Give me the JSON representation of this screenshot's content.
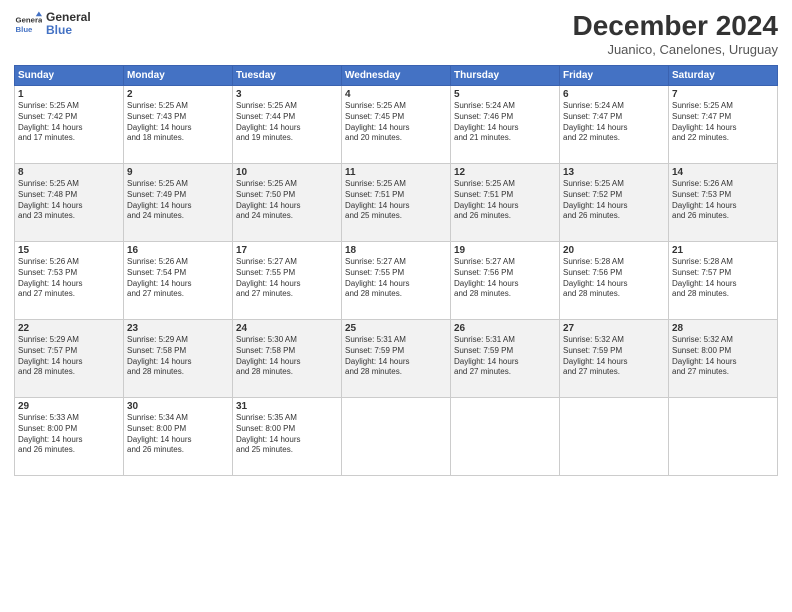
{
  "header": {
    "logo_line1": "General",
    "logo_line2": "Blue",
    "title": "December 2024",
    "subtitle": "Juanico, Canelones, Uruguay"
  },
  "weekdays": [
    "Sunday",
    "Monday",
    "Tuesday",
    "Wednesday",
    "Thursday",
    "Friday",
    "Saturday"
  ],
  "weeks": [
    [
      {
        "day": "1",
        "info": "Sunrise: 5:25 AM\nSunset: 7:42 PM\nDaylight: 14 hours\nand 17 minutes."
      },
      {
        "day": "2",
        "info": "Sunrise: 5:25 AM\nSunset: 7:43 PM\nDaylight: 14 hours\nand 18 minutes."
      },
      {
        "day": "3",
        "info": "Sunrise: 5:25 AM\nSunset: 7:44 PM\nDaylight: 14 hours\nand 19 minutes."
      },
      {
        "day": "4",
        "info": "Sunrise: 5:25 AM\nSunset: 7:45 PM\nDaylight: 14 hours\nand 20 minutes."
      },
      {
        "day": "5",
        "info": "Sunrise: 5:24 AM\nSunset: 7:46 PM\nDaylight: 14 hours\nand 21 minutes."
      },
      {
        "day": "6",
        "info": "Sunrise: 5:24 AM\nSunset: 7:47 PM\nDaylight: 14 hours\nand 22 minutes."
      },
      {
        "day": "7",
        "info": "Sunrise: 5:25 AM\nSunset: 7:47 PM\nDaylight: 14 hours\nand 22 minutes."
      }
    ],
    [
      {
        "day": "8",
        "info": "Sunrise: 5:25 AM\nSunset: 7:48 PM\nDaylight: 14 hours\nand 23 minutes."
      },
      {
        "day": "9",
        "info": "Sunrise: 5:25 AM\nSunset: 7:49 PM\nDaylight: 14 hours\nand 24 minutes."
      },
      {
        "day": "10",
        "info": "Sunrise: 5:25 AM\nSunset: 7:50 PM\nDaylight: 14 hours\nand 24 minutes."
      },
      {
        "day": "11",
        "info": "Sunrise: 5:25 AM\nSunset: 7:51 PM\nDaylight: 14 hours\nand 25 minutes."
      },
      {
        "day": "12",
        "info": "Sunrise: 5:25 AM\nSunset: 7:51 PM\nDaylight: 14 hours\nand 26 minutes."
      },
      {
        "day": "13",
        "info": "Sunrise: 5:25 AM\nSunset: 7:52 PM\nDaylight: 14 hours\nand 26 minutes."
      },
      {
        "day": "14",
        "info": "Sunrise: 5:26 AM\nSunset: 7:53 PM\nDaylight: 14 hours\nand 26 minutes."
      }
    ],
    [
      {
        "day": "15",
        "info": "Sunrise: 5:26 AM\nSunset: 7:53 PM\nDaylight: 14 hours\nand 27 minutes."
      },
      {
        "day": "16",
        "info": "Sunrise: 5:26 AM\nSunset: 7:54 PM\nDaylight: 14 hours\nand 27 minutes."
      },
      {
        "day": "17",
        "info": "Sunrise: 5:27 AM\nSunset: 7:55 PM\nDaylight: 14 hours\nand 27 minutes."
      },
      {
        "day": "18",
        "info": "Sunrise: 5:27 AM\nSunset: 7:55 PM\nDaylight: 14 hours\nand 28 minutes."
      },
      {
        "day": "19",
        "info": "Sunrise: 5:27 AM\nSunset: 7:56 PM\nDaylight: 14 hours\nand 28 minutes."
      },
      {
        "day": "20",
        "info": "Sunrise: 5:28 AM\nSunset: 7:56 PM\nDaylight: 14 hours\nand 28 minutes."
      },
      {
        "day": "21",
        "info": "Sunrise: 5:28 AM\nSunset: 7:57 PM\nDaylight: 14 hours\nand 28 minutes."
      }
    ],
    [
      {
        "day": "22",
        "info": "Sunrise: 5:29 AM\nSunset: 7:57 PM\nDaylight: 14 hours\nand 28 minutes."
      },
      {
        "day": "23",
        "info": "Sunrise: 5:29 AM\nSunset: 7:58 PM\nDaylight: 14 hours\nand 28 minutes."
      },
      {
        "day": "24",
        "info": "Sunrise: 5:30 AM\nSunset: 7:58 PM\nDaylight: 14 hours\nand 28 minutes."
      },
      {
        "day": "25",
        "info": "Sunrise: 5:31 AM\nSunset: 7:59 PM\nDaylight: 14 hours\nand 28 minutes."
      },
      {
        "day": "26",
        "info": "Sunrise: 5:31 AM\nSunset: 7:59 PM\nDaylight: 14 hours\nand 27 minutes."
      },
      {
        "day": "27",
        "info": "Sunrise: 5:32 AM\nSunset: 7:59 PM\nDaylight: 14 hours\nand 27 minutes."
      },
      {
        "day": "28",
        "info": "Sunrise: 5:32 AM\nSunset: 8:00 PM\nDaylight: 14 hours\nand 27 minutes."
      }
    ],
    [
      {
        "day": "29",
        "info": "Sunrise: 5:33 AM\nSunset: 8:00 PM\nDaylight: 14 hours\nand 26 minutes."
      },
      {
        "day": "30",
        "info": "Sunrise: 5:34 AM\nSunset: 8:00 PM\nDaylight: 14 hours\nand 26 minutes."
      },
      {
        "day": "31",
        "info": "Sunrise: 5:35 AM\nSunset: 8:00 PM\nDaylight: 14 hours\nand 25 minutes."
      },
      null,
      null,
      null,
      null
    ]
  ]
}
